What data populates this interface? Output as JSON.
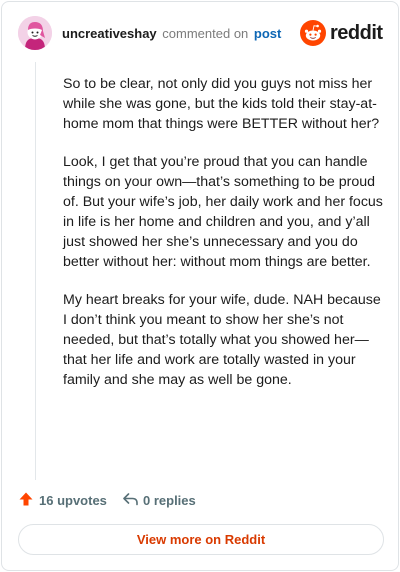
{
  "comment": {
    "username": "uncreativeshay",
    "action_text": "commented on",
    "post_link": "post",
    "paragraphs": [
      "So to be clear, not only did you guys not miss her while she was gone, but the kids told their stay-at-home mom that things were BETTER without her?",
      "Look, I get that you’re proud that you can handle things on your own—that’s something to be proud of. But your wife’s job, her daily work and her focus in life is her home and children and you, and y’all just showed her she’s unnecessary and you do better without her: without mom things are better.",
      "My heart breaks for your wife, dude. NAH because I don’t think you meant to show her she’s not needed, but that’s totally what you showed her—that her life and work are totally wasted in your family and she may as well be gone."
    ],
    "upvotes_label": "16 upvotes",
    "replies_label": "0 replies"
  },
  "brand": {
    "name": "reddit",
    "icon": "reddit-logo-icon",
    "color": "#ff4500"
  },
  "footer": {
    "view_more_label": "View more on Reddit"
  },
  "colors": {
    "upvote": "#ff4500",
    "link": "#0d67b5",
    "view_more": "#d93a00",
    "muted": "#576f76"
  }
}
